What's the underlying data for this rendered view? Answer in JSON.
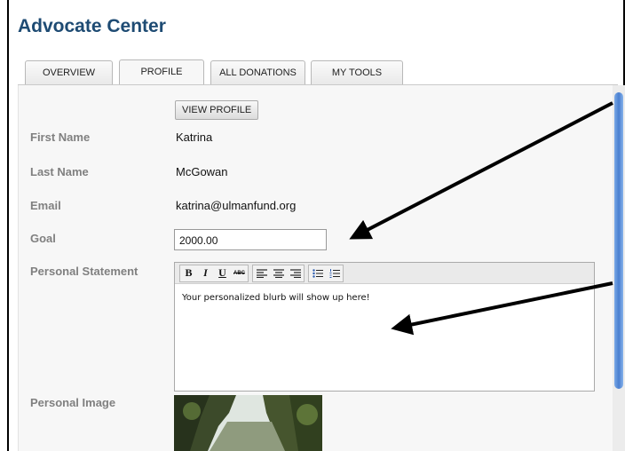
{
  "header": {
    "title": "Advocate Center"
  },
  "tabs": [
    {
      "label": "OVERVIEW"
    },
    {
      "label": "PROFILE",
      "active": true
    },
    {
      "label": "ALL DONATIONS"
    },
    {
      "label": "MY TOOLS"
    }
  ],
  "profile": {
    "view_profile_label": "VIEW PROFILE",
    "first_name_label": "First Name",
    "first_name": "Katrina",
    "last_name_label": "Last Name",
    "last_name": "McGowan",
    "email_label": "Email",
    "email": "katrina@ulmanfund.org",
    "goal_label": "Goal",
    "goal": "2000.00",
    "statement_label": "Personal Statement",
    "statement_text": "Your personalized blurb will show up here!",
    "image_label": "Personal Image"
  },
  "editor_toolbar": {
    "bold": "B",
    "italic": "I",
    "underline": "U",
    "strike": "ABC"
  },
  "colors": {
    "title": "#1e4b73",
    "label": "#808080",
    "scrollbar": "#4a7fd0"
  }
}
